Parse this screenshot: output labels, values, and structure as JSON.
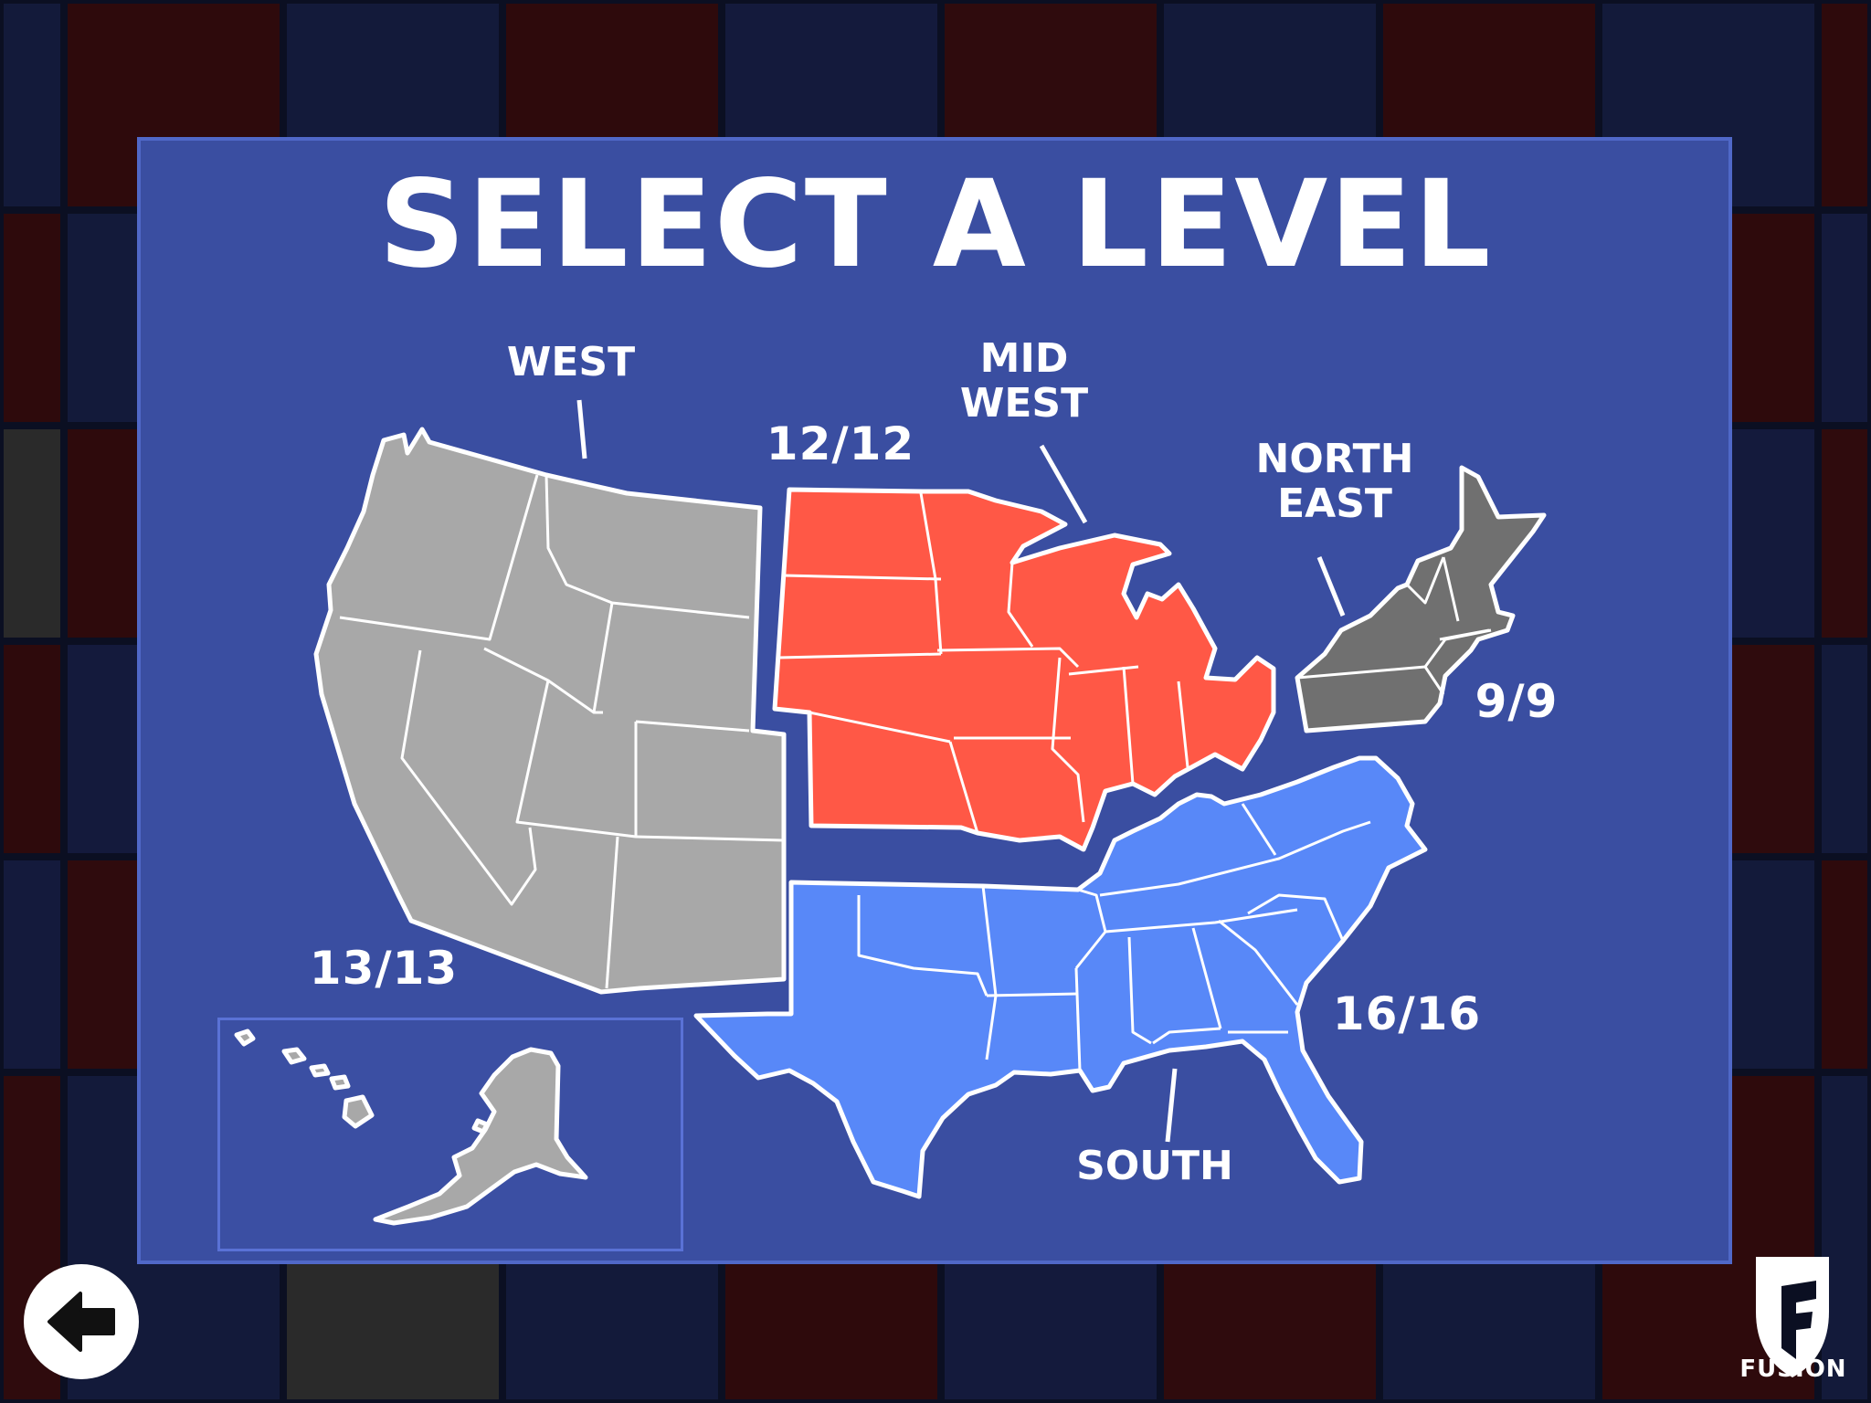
{
  "title": "SELECT A LEVEL",
  "regions": {
    "west": {
      "name": "WEST",
      "progress": "13/13",
      "color": "#a8a8a8"
    },
    "midwest": {
      "name_line1": "MID",
      "name_line2": "WEST",
      "progress": "12/12",
      "color": "#ff5846"
    },
    "northeast": {
      "name_line1": "NORTH",
      "name_line2": "EAST",
      "progress": "9/9",
      "color": "#707070"
    },
    "south": {
      "name": "SOUTH",
      "progress": "16/16",
      "color": "#5888f8"
    }
  },
  "icons": {
    "back": "back-arrow-icon",
    "logo": "fusion-logo-icon"
  },
  "brand": {
    "name": "FUSION"
  },
  "colors": {
    "panel": "#3a4ea1",
    "panel_border": "#5068c8",
    "background": "#0b0f22"
  }
}
